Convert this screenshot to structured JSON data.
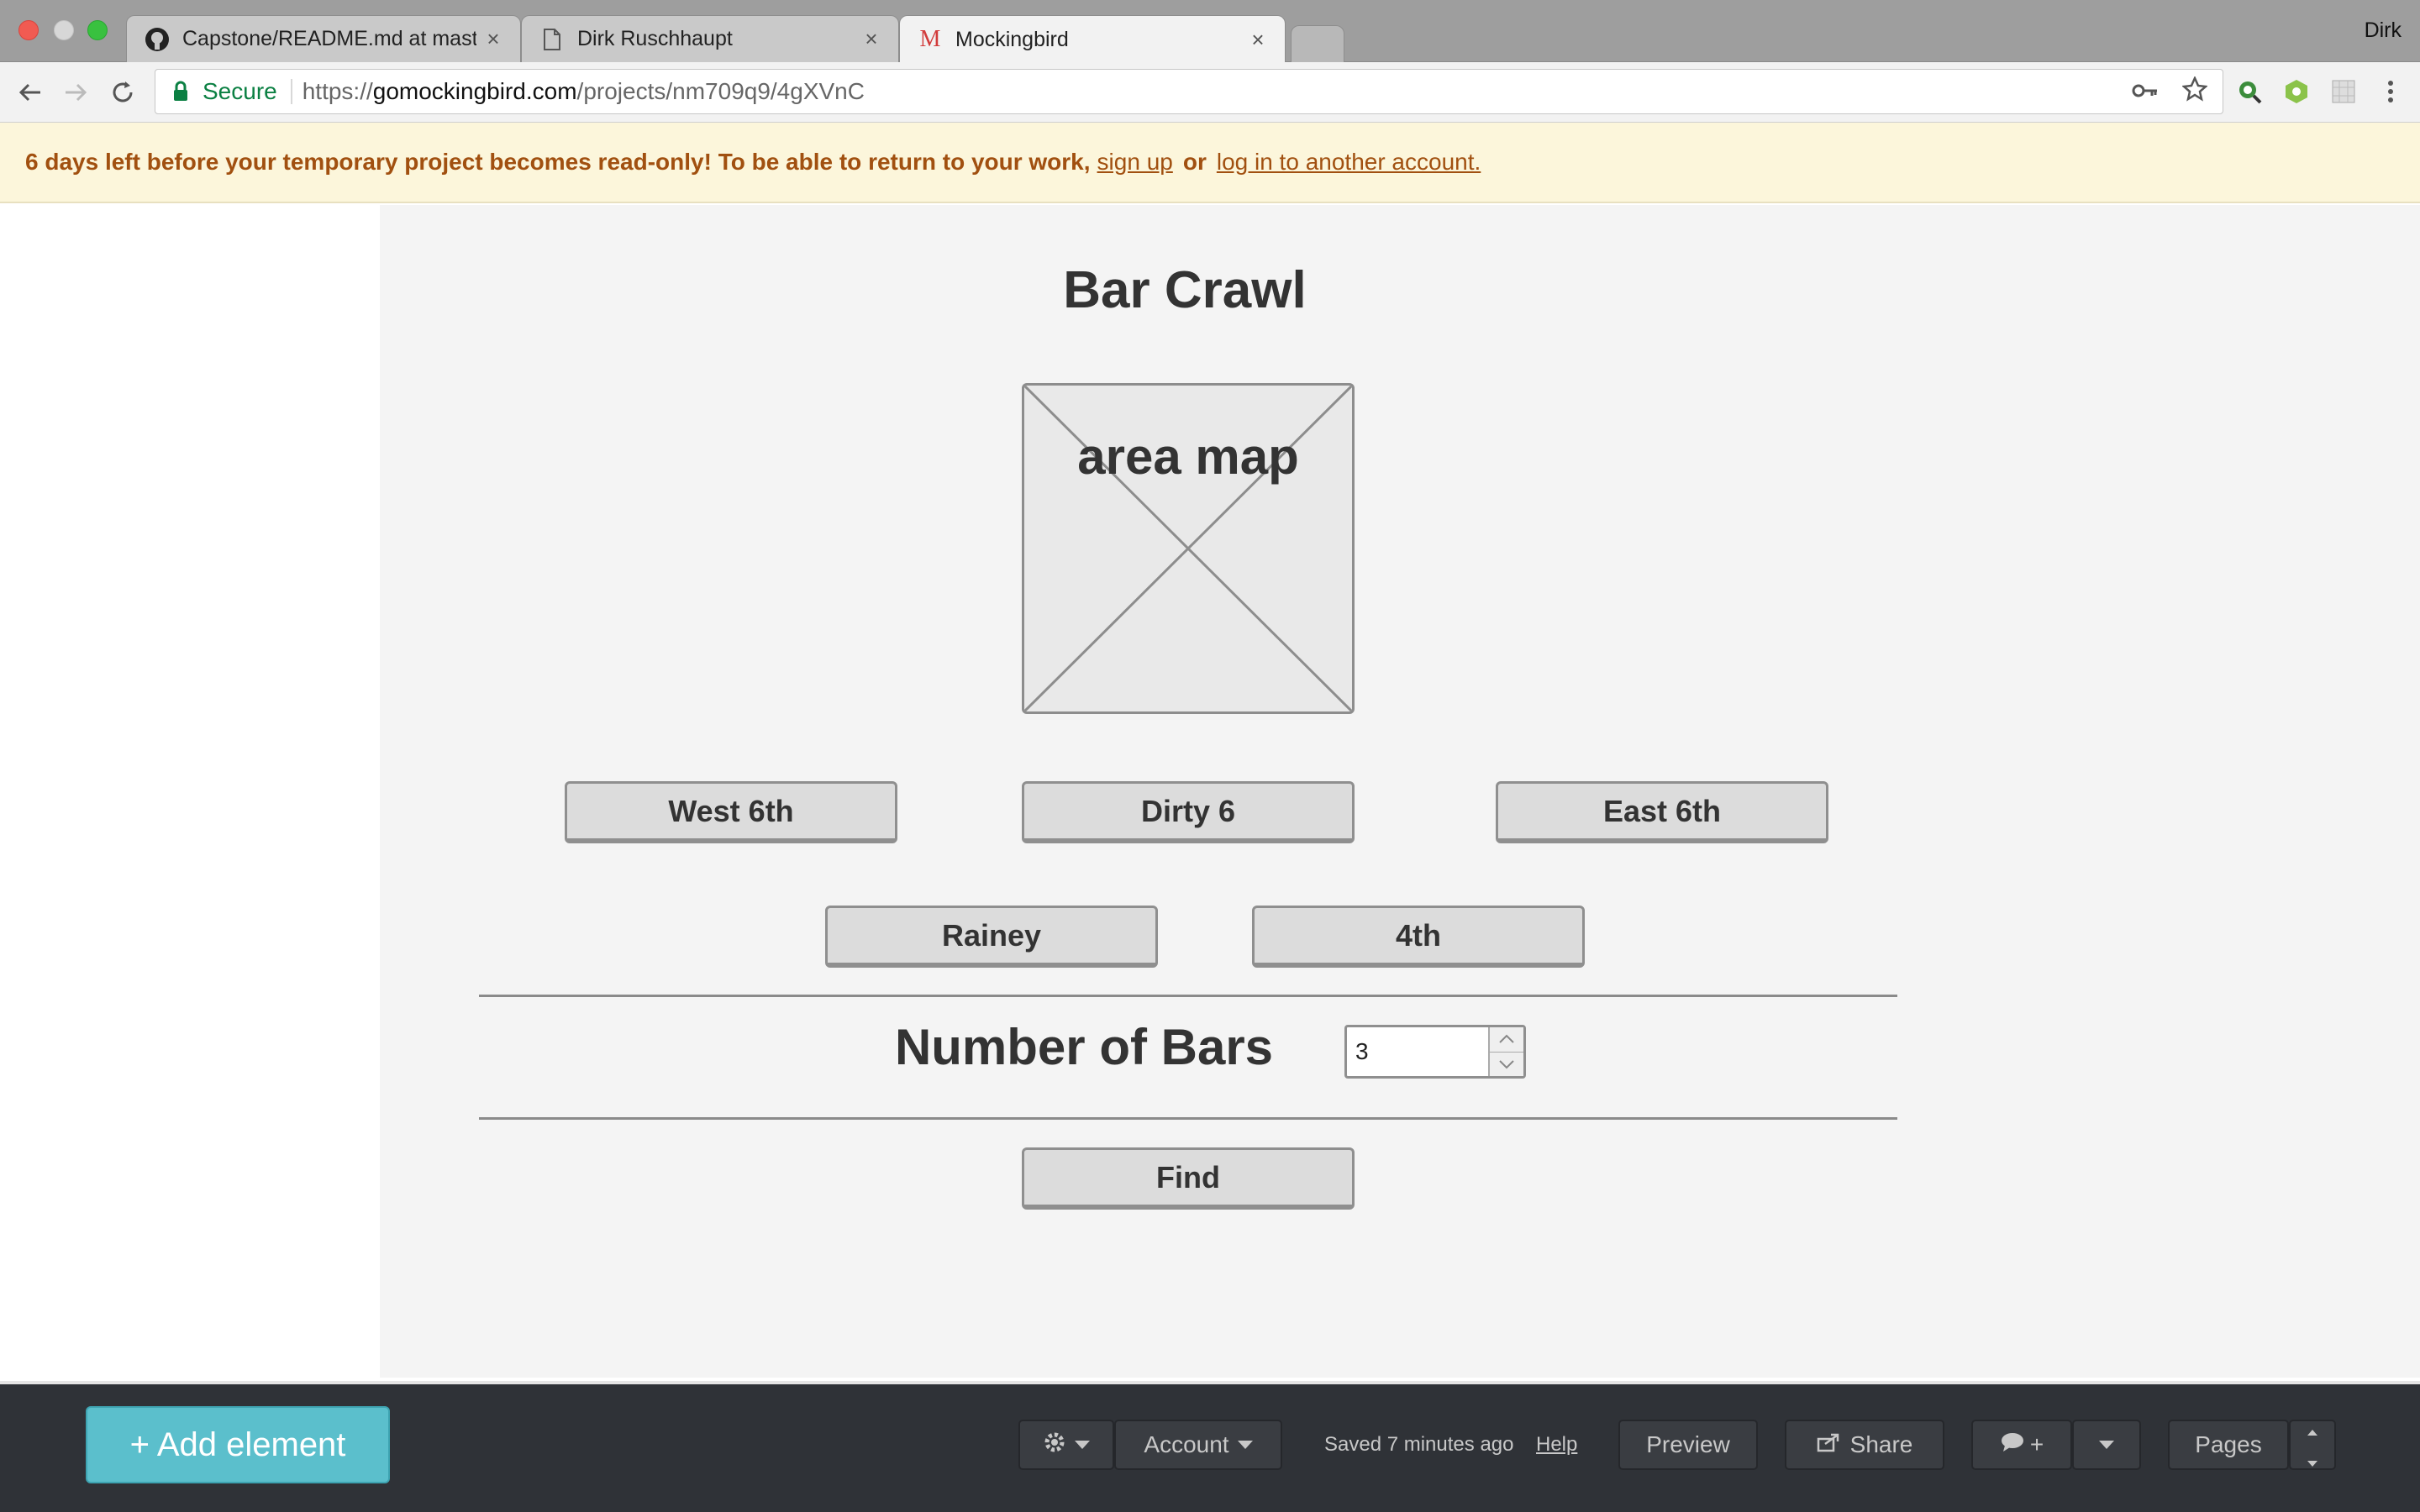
{
  "browser": {
    "tabs": [
      {
        "title": "Capstone/README.md at mast",
        "icon": "github-icon",
        "active": false
      },
      {
        "title": "Dirk Ruschhaupt",
        "icon": "page-icon",
        "active": false
      },
      {
        "title": "Mockingbird",
        "icon": "mockingbird-icon",
        "active": true
      }
    ],
    "profile_name": "Dirk",
    "address": {
      "secure_label": "Secure",
      "scheme": "https://",
      "host": "gomockingbird.com",
      "path": "/projects/nm709q9/4gXVnC"
    }
  },
  "banner": {
    "message": "6 days left before your temporary project becomes read-only! To be able to return to your work,",
    "signup_link": "sign up",
    "or_text": "or",
    "login_link": "log in to another account."
  },
  "wireframe": {
    "title": "Bar Crawl",
    "image_label": "area map",
    "district_buttons": [
      "West 6th",
      "Dirty 6",
      "East 6th",
      "Rainey",
      "4th"
    ],
    "bars_label": "Number of Bars",
    "bars_value": "3",
    "find_button": "Find"
  },
  "bottombar": {
    "add_element": "+ Add element",
    "account": "Account",
    "saved_status": "Saved 7 minutes ago",
    "help": "Help",
    "preview": "Preview",
    "share": "Share",
    "comment_add": "+",
    "pages": "Pages"
  },
  "colors": {
    "banner_bg": "#fcf6db",
    "banner_text": "#a15010",
    "add_button": "#5bbfcc",
    "bottombar_bg": "#2f3237",
    "secure_green": "#0b8043"
  }
}
